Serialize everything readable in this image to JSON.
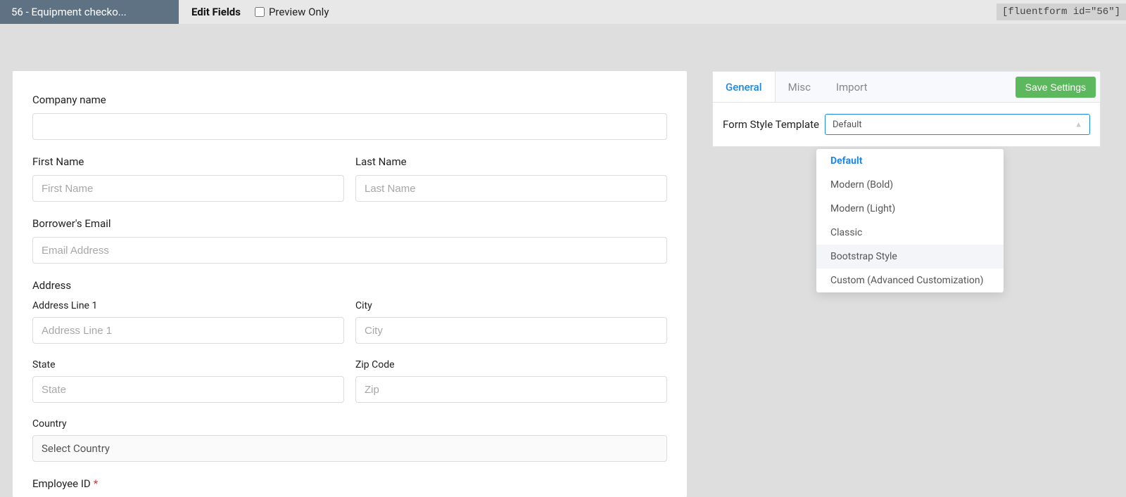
{
  "topbar": {
    "form_tab": "56 - Equipment checko...",
    "edit_tab": "Edit Fields",
    "preview_label": "Preview Only",
    "shortcode": "[fluentform id=\"56\"]"
  },
  "form": {
    "company_label": "Company name",
    "first_name_label": "First Name",
    "first_name_ph": "First Name",
    "last_name_label": "Last Name",
    "last_name_ph": "Last Name",
    "email_label": "Borrower's Email",
    "email_ph": "Email Address",
    "address_label": "Address",
    "addr1_label": "Address Line 1",
    "addr1_ph": "Address Line 1",
    "city_label": "City",
    "city_ph": "City",
    "state_label": "State",
    "state_ph": "State",
    "zip_label": "Zip Code",
    "zip_ph": "Zip",
    "country_label": "Country",
    "country_ph": "Select Country",
    "employee_id_label": "Employee ID"
  },
  "settings": {
    "tabs": {
      "general": "General",
      "misc": "Misc",
      "import": "Import"
    },
    "save": "Save Settings",
    "template_label": "Form Style Template",
    "template_value": "Default",
    "options": [
      "Default",
      "Modern (Bold)",
      "Modern (Light)",
      "Classic",
      "Bootstrap Style",
      "Custom (Advanced Customization)"
    ]
  }
}
